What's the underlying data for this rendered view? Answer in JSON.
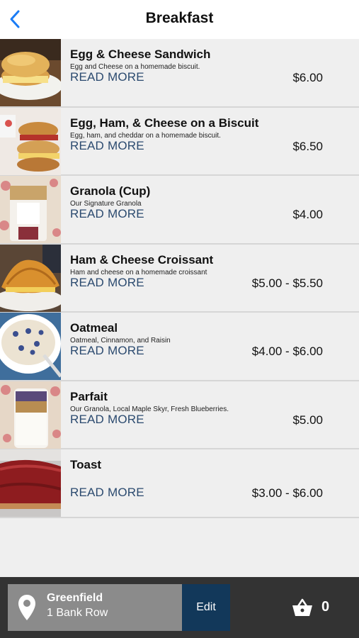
{
  "header": {
    "title": "Breakfast",
    "back_icon": "chevron-left-icon",
    "accent": "#1a7cf5"
  },
  "menu": {
    "read_more_label": "READ MORE",
    "items": [
      {
        "name": "Egg & Cheese Sandwich",
        "description": "Egg and Cheese on a homemade biscuit.",
        "read_more": "READ MORE",
        "price": "$6.00"
      },
      {
        "name": "Egg, Ham, & Cheese on a Biscuit",
        "description": "Egg, ham, and cheddar on a homemade biscuit.",
        "read_more": "READ MORE",
        "price": "$6.50"
      },
      {
        "name": "Granola (Cup)",
        "description": "Our Signature Granola",
        "read_more": "READ MORE",
        "price": "$4.00"
      },
      {
        "name": "Ham & Cheese Croissant",
        "description": "Ham and cheese on a homemade croissant",
        "read_more": "READ MORE",
        "price": "$5.00 - $5.50"
      },
      {
        "name": "Oatmeal",
        "description": "Oatmeal, Cinnamon, and Raisin",
        "read_more": "READ MORE",
        "price": "$4.00 - $6.00"
      },
      {
        "name": "Parfait",
        "description": "Our Granola, Local Maple Skyr, Fresh Blueberries.",
        "read_more": "READ MORE",
        "price": "$5.00"
      },
      {
        "name": "Toast",
        "description": "",
        "read_more": "READ MORE",
        "price": "$3.00 - $6.00"
      }
    ]
  },
  "footer": {
    "location_name": "Greenfield",
    "location_address": "1 Bank Row",
    "edit_label": "Edit",
    "cart_count": "0",
    "location_icon": "map-pin-icon",
    "cart_icon": "basket-icon",
    "edit_color": "#12385a"
  }
}
